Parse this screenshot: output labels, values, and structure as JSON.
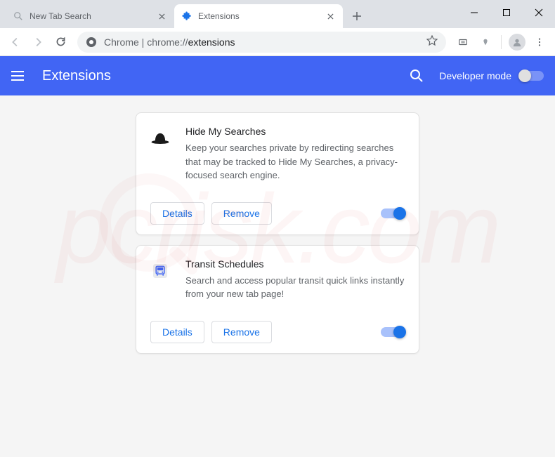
{
  "window": {
    "tabs": [
      {
        "title": "New Tab Search",
        "active": false
      },
      {
        "title": "Extensions",
        "active": true
      }
    ]
  },
  "toolbar": {
    "url_prefix": "Chrome | chrome://",
    "url_path": "extensions"
  },
  "header": {
    "title": "Extensions",
    "dev_mode_label": "Developer mode"
  },
  "extensions": [
    {
      "icon": "hat",
      "name": "Hide My Searches",
      "description": "Keep your searches private by redirecting searches that may be tracked to Hide My Searches, a privacy-focused search engine.",
      "enabled": true
    },
    {
      "icon": "bus",
      "name": "Transit Schedules",
      "description": "Search and access popular transit quick links instantly from your new tab page!",
      "enabled": true
    }
  ],
  "buttons": {
    "details": "Details",
    "remove": "Remove"
  },
  "watermark": "pcrisk.com"
}
